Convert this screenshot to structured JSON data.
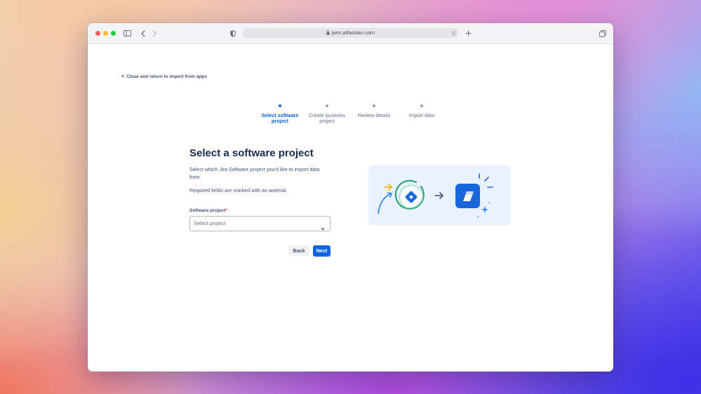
{
  "browser": {
    "url": "jwm.atlassian.com"
  },
  "page": {
    "close_link": "Close and return to import from apps",
    "steps": [
      {
        "line1": "Select software",
        "line2": "project",
        "active": true
      },
      {
        "line1": "Create business",
        "line2": "project",
        "active": false
      },
      {
        "line1": "Review details",
        "line2": "",
        "active": false
      },
      {
        "line1": "Import data",
        "line2": "",
        "active": false
      }
    ],
    "heading": "Select a software project",
    "description": "Select which Jira Software project you'd like to import data from.",
    "required_note": "Required fields are marked with an asterisk.",
    "field": {
      "label": "Software project",
      "required_mark": "*",
      "placeholder": "Select project"
    },
    "buttons": {
      "back": "Back",
      "next": "Next"
    }
  },
  "colors": {
    "accent": "#0c66e4",
    "heading": "#172b4d",
    "required": "#de350b"
  },
  "icons": [
    "sidebar-icon",
    "back-arrow-icon",
    "forward-arrow-icon",
    "shield-icon",
    "lock-icon",
    "reload-icon",
    "plus-icon",
    "tabs-icon",
    "chevron-down-icon",
    "jira-software-icon",
    "jira-work-management-icon"
  ]
}
